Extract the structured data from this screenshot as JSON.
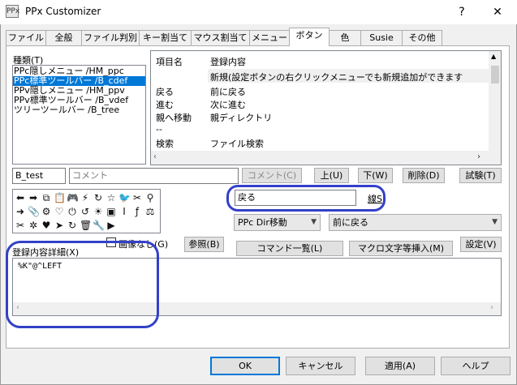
{
  "window": {
    "title": "PPx Customizer",
    "app_icon": "PPx",
    "help_glyph": "?",
    "close_glyph": "✕"
  },
  "tabs": [
    "ファイル",
    "全般",
    "ファイル判別",
    "キー割当て",
    "マウス割当て",
    "メニュー",
    "ボタン",
    "色",
    "Susie",
    "その他"
  ],
  "active_tab": "ボタン",
  "kind": {
    "label": "種類(T)",
    "items": [
      "PPc隠しメニュー /HM_ppc",
      "PPc標準ツールバー /B_cdef",
      "PPv隠しメニュー /HM_ppv",
      "PPv標準ツールバー /B_vdef",
      "ツリーツールバー /B_tree"
    ],
    "selected_index": 1
  },
  "entry_table": {
    "headers": [
      "項目名",
      "登録内容"
    ],
    "rows": [
      [
        "",
        "新規(設定ボタンの右クリックメニューでも新規追加ができます"
      ],
      [
        "戻る",
        "前に戻る"
      ],
      [
        "進む",
        "次に進む"
      ],
      [
        "親へ移動",
        "親ディレクトリ"
      ],
      [
        "--",
        ""
      ],
      [
        "検索",
        "ファイル検索"
      ]
    ],
    "highlighted_row": 0
  },
  "name_field": "B_test",
  "comment_placeholder": "コメント",
  "buttons": {
    "comment": "コメント(C)",
    "up": "上(U)",
    "down": "下(W)",
    "delete": "削除(D)",
    "test": "試験(T)",
    "linestyle": "線S",
    "imageless": "画像なし(G)",
    "browse": "参照(B)",
    "command_list": "コマンド一覧(L)",
    "macro_insert": "マクロ文字等挿入(M)",
    "settings": "設定(V)"
  },
  "item_name_value": "戻る",
  "combo_category": "PPc Dir移動",
  "combo_command": "前に戻る",
  "detail": {
    "label": "登録内容詳細(X)",
    "value": "%K\"@^LEFT"
  },
  "footer": {
    "ok": "OK",
    "cancel": "キャンセル",
    "apply": "適用(A)",
    "help": "ヘルプ"
  },
  "toolbar_icons": [
    [
      "back-icon",
      "⬅"
    ],
    [
      "forward-icon",
      "➡"
    ],
    [
      "copy-icon",
      "⧉"
    ],
    [
      "paste-icon",
      "📋"
    ],
    [
      "gamepad-icon",
      "🎮"
    ],
    [
      "bolt-icon",
      "⚡"
    ],
    [
      "refresh-icon",
      "↻"
    ],
    [
      "star-icon",
      "☆"
    ],
    [
      "bird-icon",
      "🐦"
    ],
    [
      "tools-icon",
      "✂"
    ],
    [
      "search-icon",
      "⚲"
    ],
    [
      "arrow-right-icon",
      "➜"
    ],
    [
      "clip-icon",
      "📎"
    ],
    [
      "gear-icon",
      "⚙"
    ],
    [
      "heart-icon",
      "♡"
    ],
    [
      "power-icon",
      "⏻"
    ],
    [
      "reload-icon",
      "↺"
    ],
    [
      "sun-icon",
      "☀"
    ],
    [
      "window-icon",
      "▣"
    ],
    [
      "pipe-icon",
      "I"
    ],
    [
      "wrench-icon",
      "ƒ"
    ],
    [
      "scale-icon",
      "⚖"
    ],
    [
      "cut-icon",
      "✂"
    ],
    [
      "gear2-icon",
      "✲"
    ],
    [
      "heart-fill-icon",
      "♥"
    ],
    [
      "send-icon",
      "➤"
    ],
    [
      "cycle-icon",
      "↻"
    ],
    [
      "trash-icon",
      "🗑"
    ],
    [
      "wrench2-icon",
      "🔧"
    ],
    [
      "youtube-icon",
      "▶"
    ]
  ]
}
